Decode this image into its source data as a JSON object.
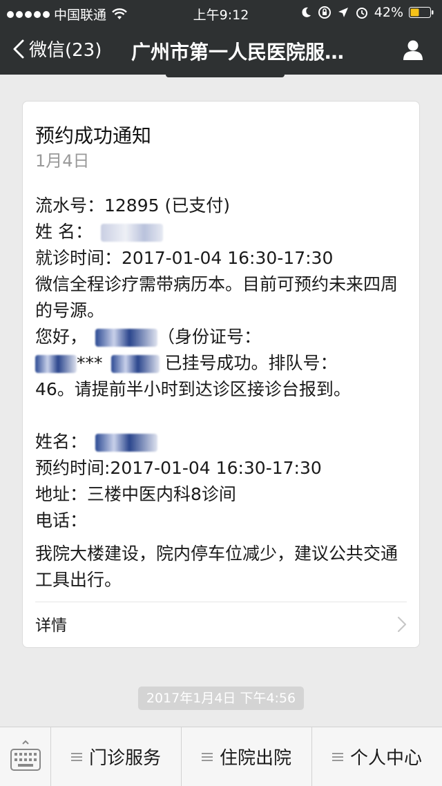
{
  "status_bar": {
    "carrier": "中国联通",
    "time": "上午9:12",
    "battery": "42%"
  },
  "nav": {
    "back_label": "微信(23)",
    "title": "广州市第一人民医院服…"
  },
  "card": {
    "title": "预约成功通知",
    "date": "1月4日",
    "serial_line": "流水号：12895    (已支付)",
    "name_line": "姓    名：",
    "visit_time_line": "就诊时间：2017-01-04 16:30-17:30",
    "note_line": "微信全程诊疗需带病历本。目前可预约未来四周的号源。",
    "greeting_prefix": "您好，",
    "greeting_id": "（身份证号：",
    "id_masked": "***",
    "success_text": "已挂号成功。排队号：",
    "queue_text": "46。请提前半小时到达诊区接诊台报到。",
    "name2_line": "姓名：",
    "appt_time_line": "预约时间:2017-01-04 16:30-17:30",
    "address_line": "地址：三楼中医内科8诊间",
    "phone_line": "电话：",
    "notice": "我院大楼建设，院内停车位减少，建议公共交通工具出行。",
    "detail_label": "详情"
  },
  "timestamp": "2017年1月4日 下午4:56",
  "menu": {
    "items": [
      {
        "label": "门诊服务"
      },
      {
        "label": "住院出院"
      },
      {
        "label": "个人中心"
      }
    ]
  },
  "colors": {
    "header_bg": "#2e3132",
    "page_bg": "#ebebeb",
    "card_bg": "#ffffff",
    "secondary_text": "#999999"
  }
}
